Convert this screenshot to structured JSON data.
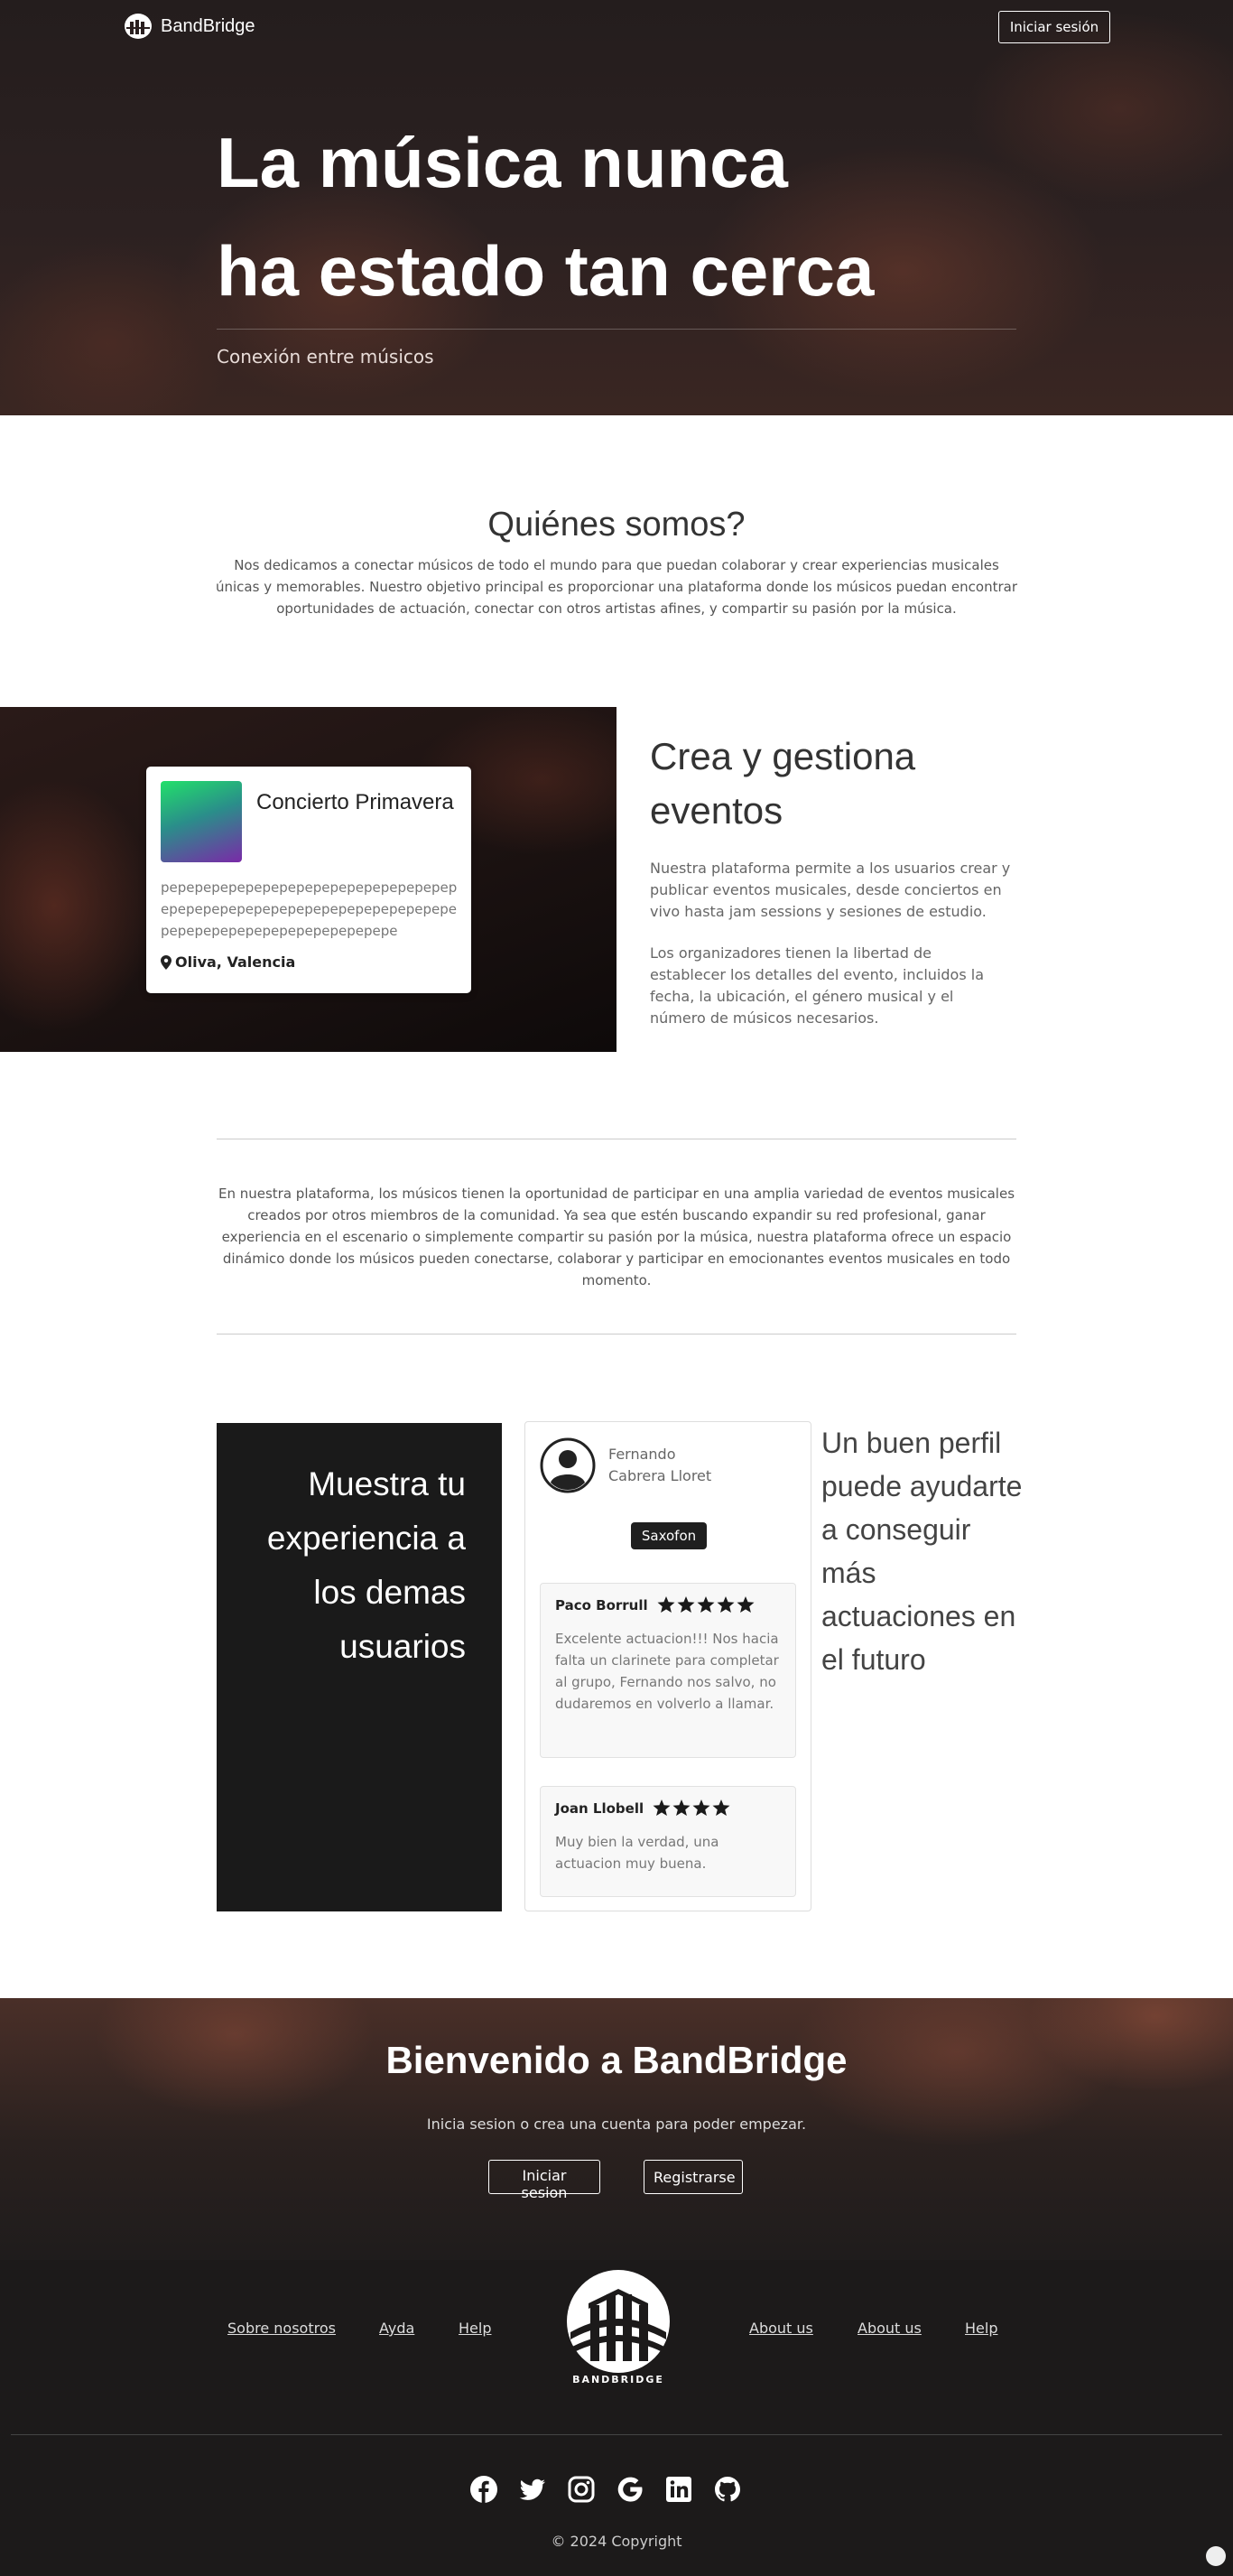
{
  "nav": {
    "brand": "BandBridge",
    "login_label": "Iniciar sesión"
  },
  "hero": {
    "title_line1": "La música nunca",
    "title_line2": "ha estado tan cerca",
    "subtitle": "Conexión entre músicos"
  },
  "about": {
    "title": "Quiénes somos?",
    "text": "Nos dedicamos a conectar músicos de todo el mundo para que puedan colaborar y crear experiencias musicales únicas y memorables. Nuestro objetivo principal es proporcionar una plataforma donde los músicos puedan encontrar oportunidades de actuación, conectar con otros artistas afines, y compartir su pasión por la música."
  },
  "event_card": {
    "title": "Concierto Primavera",
    "description": "pepepepepepepepepepepepepepepepepepepepepepepepepepepepepepepepepepepepepepepepepepepepepepepepepe",
    "location": "Oliva, Valencia"
  },
  "events": {
    "heading": "Crea y gestiona eventos",
    "p1": "Nuestra plataforma permite a los usuarios crear y publicar eventos musicales, desde conciertos en vivo hasta jam sessions y sesiones de estudio.",
    "p2": "Los organizadores tienen la libertad de establecer los detalles del evento, incluidos la fecha, la ubicación, el género musical y el número de músicos necesarios."
  },
  "participate": {
    "text": "En nuestra plataforma, los músicos tienen la oportunidad de participar en una amplia variedad de eventos musicales creados por otros miembros de la comunidad. Ya sea que estén buscando expandir su red profesional, ganar experiencia en el escenario o simplemente compartir su pasión por la música, nuestra plataforma ofrece un espacio dinámico donde los músicos pueden conectarse, colaborar y participar en emocionantes eventos musicales en todo momento."
  },
  "experience": {
    "title": "Muestra tu experiencia a los demas usuarios"
  },
  "profile": {
    "name": "Fernando Cabrera Lloret",
    "instrument": "Saxofon",
    "reviews": [
      {
        "author": "Paco Borrull",
        "rating": 5,
        "text": "Excelente actuacion!!! Nos hacia falta un clarinete para completar al grupo, Fernando nos salvo, no dudaremos en volverlo a llamar."
      },
      {
        "author": "Joan Llobell",
        "rating": 4,
        "text": "Muy bien la verdad, una actuacion muy buena."
      }
    ]
  },
  "profile_heading": "Un buen perfil puede ayudarte a conseguir más actuaciones en el futuro",
  "welcome": {
    "title": "Bienvenido a BandBridge",
    "subtitle": "Inicia sesion o crea una cuenta para poder empezar.",
    "login_label": "Iniciar sesion",
    "register_label": "Registrarse"
  },
  "footer": {
    "left_links": [
      "Sobre nosotros",
      "Ayda",
      "Help"
    ],
    "right_links": [
      "About us",
      "About us",
      "Help"
    ],
    "logo_text": "BANDBRIDGE",
    "socials": [
      "facebook-icon",
      "twitter-icon",
      "instagram-icon",
      "google-icon",
      "linkedin-icon",
      "github-icon"
    ],
    "copyright": "© 2024 Copyright"
  }
}
